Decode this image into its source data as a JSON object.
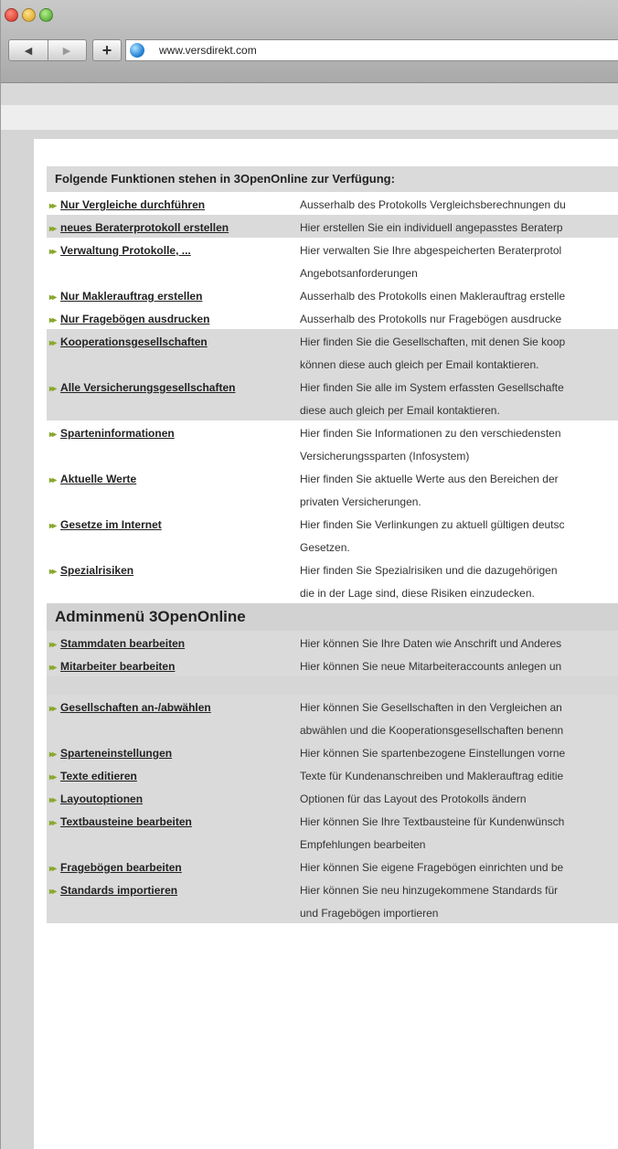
{
  "window": {
    "url": "www.versdirekt.com",
    "controls": [
      "close",
      "minimize",
      "zoom"
    ]
  },
  "section1": {
    "title": "Folgende Funktionen stehen in 3OpenOnline zur Verfügung:",
    "items": [
      {
        "link": "Nur Vergleiche durchführen",
        "desc": [
          "Ausserhalb des Protokolls Vergleichsberechnungen du"
        ]
      },
      {
        "link": "neues Beraterprotokoll erstellen",
        "desc": [
          "Hier erstellen Sie ein individuell angepasstes Beraterp"
        ]
      },
      {
        "link": "Verwaltung Protokolle, ...",
        "desc": [
          "Hier verwalten Sie Ihre abgespeicherten Beraterprotol",
          "Angebotsanforderungen"
        ]
      },
      {
        "link": "Nur Maklerauftrag erstellen",
        "desc": [
          "Ausserhalb des Protokolls einen Maklerauftrag erstelle"
        ]
      },
      {
        "link": "Nur Fragebögen ausdrucken",
        "desc": [
          "Ausserhalb des Protokolls nur Fragebögen ausdrucke"
        ]
      },
      {
        "link": "Kooperationsgesellschaften",
        "desc": [
          "Hier finden Sie die Gesellschaften, mit denen Sie koop",
          "können diese auch gleich per Email kontaktieren."
        ]
      },
      {
        "link": "Alle Versicherungsgesellschaften",
        "desc": [
          "Hier finden Sie alle im System erfassten Gesellschafte",
          "diese auch gleich per Email kontaktieren."
        ]
      },
      {
        "link": "Sparteninformationen",
        "desc": [
          "Hier finden Sie Informationen zu den verschiedensten",
          "Versicherungssparten (Infosystem)"
        ]
      },
      {
        "link": "Aktuelle Werte",
        "desc": [
          "Hier finden Sie aktuelle Werte aus den Bereichen der",
          "privaten Versicherungen."
        ]
      },
      {
        "link": "Gesetze im Internet",
        "desc": [
          "Hier finden Sie Verlinkungen zu aktuell gültigen deutsc",
          "Gesetzen."
        ]
      },
      {
        "link": "Spezialrisiken",
        "desc": [
          "Hier finden Sie Spezialrisiken und die dazugehörigen",
          "die in der Lage sind, diese Risiken einzudecken."
        ]
      }
    ]
  },
  "section2": {
    "title": "Adminmenü 3OpenOnline",
    "items": [
      {
        "link": "Stammdaten bearbeiten",
        "desc": [
          "Hier können Sie Ihre Daten wie Anschrift und Anderes"
        ]
      },
      {
        "link": "Mitarbeiter bearbeiten",
        "desc": [
          "Hier können Sie neue Mitarbeiteraccounts anlegen un"
        ]
      },
      {
        "link": "Gesellschaften an-/abwählen",
        "desc": [
          "Hier können Sie Gesellschaften in den Vergleichen an",
          "abwählen und die Kooperationsgesellschaften benenn"
        ]
      },
      {
        "link": "Sparteneinstellungen",
        "desc": [
          "Hier können Sie spartenbezogene Einstellungen vorne"
        ]
      },
      {
        "link": "Texte editieren",
        "desc": [
          "Texte für Kundenanschreiben und Maklerauftrag editie"
        ]
      },
      {
        "link": "Layoutoptionen",
        "desc": [
          "Optionen für das Layout des Protokolls ändern"
        ]
      },
      {
        "link": "Textbausteine bearbeiten",
        "desc": [
          "Hier können Sie Ihre Textbausteine für Kundenwünsch",
          "Empfehlungen bearbeiten"
        ]
      },
      {
        "link": "Fragebögen bearbeiten",
        "desc": [
          "Hier können Sie eigene Fragebögen einrichten und be"
        ]
      },
      {
        "link": "Standards importieren",
        "desc": [
          "Hier können Sie neu hinzugekommene Standards für",
          "und Fragebögen importieren"
        ]
      }
    ]
  },
  "colors": {
    "accent": "#8aa82c",
    "row_shade": "#dadada"
  },
  "icons": [
    "back-arrow-icon",
    "forward-arrow-icon",
    "plus-icon",
    "globe-icon",
    "double-arrow-icon"
  ]
}
